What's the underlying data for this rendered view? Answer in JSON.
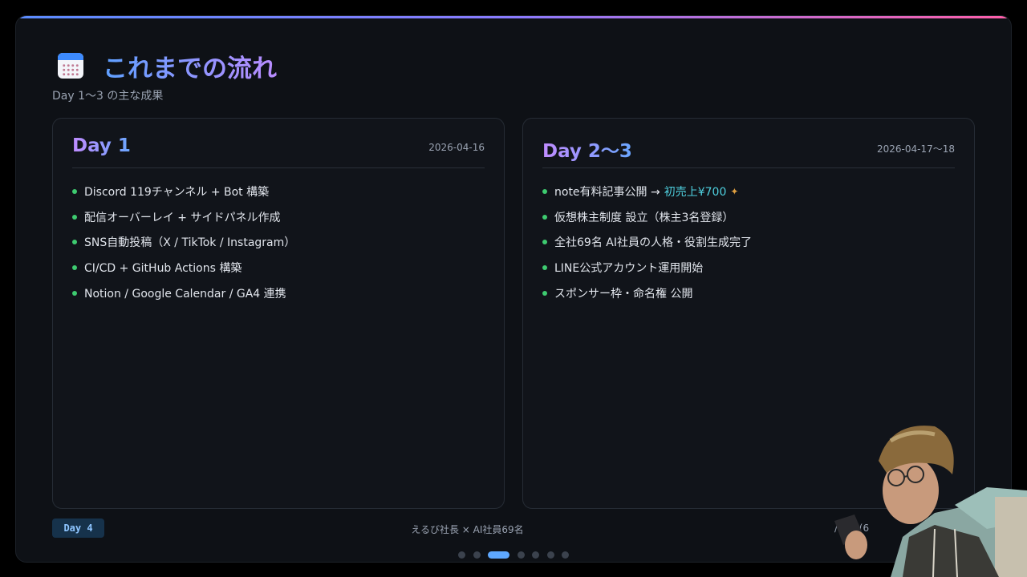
{
  "header": {
    "icon": "calendar-icon",
    "title": "これまでの流れ",
    "subtitle": "Day 1〜3 の主な成果"
  },
  "cards": [
    {
      "title": "Day 1",
      "date": "2026-04-16",
      "items": [
        "Discord 119チャンネル + Bot 構築",
        "配信オーバーレイ + サイドパネル作成",
        "SNS自動投稿（X / TikTok / Instagram）",
        "CI/CD + GitHub Actions 構築",
        "Notion / Google Calendar / GA4 連携"
      ]
    },
    {
      "title": "Day 2〜3",
      "date": "2026-04-17〜18",
      "items": [
        "note有料記事公開 →",
        "仮想株主制度 設立（株主3名登録）",
        "全社69名 AI社員の人格・役割生成完了",
        "LINE公式アカウント運用開始",
        "スポンサー枠・命名権 公開"
      ],
      "highlight": "初売上¥700",
      "highlight_icon": "party-popper-icon"
    }
  ],
  "footer": {
    "badge": "Day  4",
    "center": "えるび社長 × AI社員69名",
    "page": "/100 (6"
  },
  "nav": {
    "total": 7,
    "active_index": 2
  },
  "colors": {
    "accent_blue": "#5ea8ff",
    "accent_purple": "#b98cff",
    "bullet_green": "#3ecb70",
    "highlight_cyan": "#4fd1e0",
    "card_bg": "#11141a",
    "frame_bg": "#0e1116"
  }
}
